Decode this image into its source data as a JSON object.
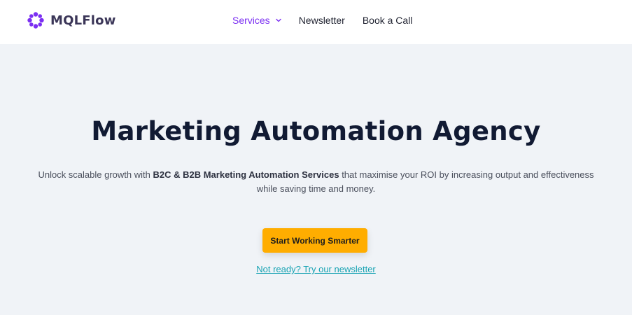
{
  "brand": {
    "name": "MQLFlow",
    "logo_icon": "circle-dots-logo-icon",
    "accent_color": "#7b2ff2"
  },
  "nav": {
    "items": [
      {
        "label": "Services",
        "active": true,
        "has_dropdown": true,
        "icon": "chevron-down-icon"
      },
      {
        "label": "Newsletter",
        "active": false
      },
      {
        "label": "Book a Call",
        "active": false
      }
    ]
  },
  "hero": {
    "background": "#f0f3f7",
    "title": "Marketing Automation Agency",
    "description": {
      "prefix": "Unlock scalable growth with ",
      "emphasis": "B2C & B2B Marketing Automation Services",
      "suffix": " that maximise your ROI by increasing output and effectiveness while saving time and money."
    },
    "cta_label": "Start Working Smarter",
    "cta_color": "#ffad00",
    "secondary_link": "Not ready? Try our newsletter",
    "secondary_link_color": "#18a3b3"
  }
}
